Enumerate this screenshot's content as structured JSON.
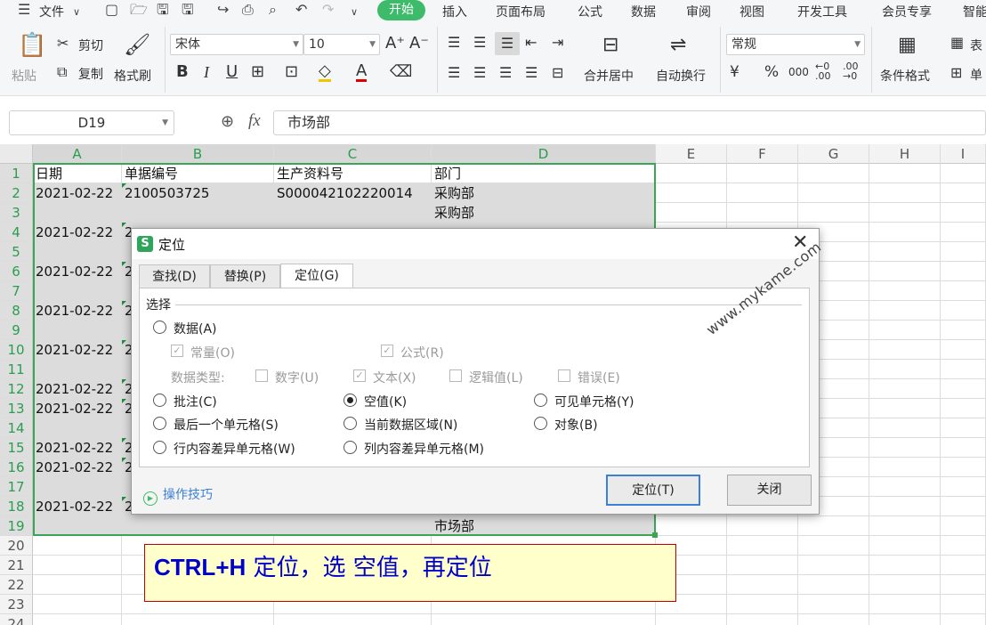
{
  "menubar": {
    "file_label": "文件",
    "tabs": [
      "开始",
      "插入",
      "页面布局",
      "公式",
      "数据",
      "审阅",
      "视图",
      "开发工具",
      "会员专享",
      "智能"
    ]
  },
  "ribbon": {
    "paste": "粘贴",
    "cut": "剪切",
    "copy": "复制",
    "format_painter": "格式刷",
    "font_name": "宋体",
    "font_size": "10",
    "merge_center": "合并居中",
    "wrap_text": "自动换行",
    "number_format": "常规",
    "conditional_format": "条件格式",
    "table_style": "表",
    "cell_more": "单"
  },
  "formula_bar": {
    "name_box": "D19",
    "fx_symbol": "fx",
    "content": "市场部"
  },
  "sheet": {
    "columns": [
      "A",
      "B",
      "C",
      "D",
      "E",
      "F",
      "G",
      "H",
      "I"
    ],
    "rows": [
      {
        "n": "1",
        "a": "日期",
        "b": "单据编号",
        "c": "生产资料号",
        "d": "部门"
      },
      {
        "n": "2",
        "a": "2021-02-22",
        "b": "2100503725",
        "c": "S000042102220014",
        "d": "采购部"
      },
      {
        "n": "3",
        "a": "",
        "b": "",
        "c": "",
        "d": "采购部"
      },
      {
        "n": "4",
        "a": "2021-02-22",
        "b": "2",
        "c": "",
        "d": ""
      },
      {
        "n": "5",
        "a": "",
        "b": "",
        "c": "",
        "d": ""
      },
      {
        "n": "6",
        "a": "2021-02-22",
        "b": "2",
        "c": "",
        "d": ""
      },
      {
        "n": "7",
        "a": "",
        "b": "",
        "c": "",
        "d": ""
      },
      {
        "n": "8",
        "a": "2021-02-22",
        "b": "2",
        "c": "",
        "d": ""
      },
      {
        "n": "9",
        "a": "",
        "b": "",
        "c": "",
        "d": ""
      },
      {
        "n": "10",
        "a": "2021-02-22",
        "b": "2",
        "c": "",
        "d": ""
      },
      {
        "n": "11",
        "a": "",
        "b": "",
        "c": "",
        "d": ""
      },
      {
        "n": "12",
        "a": "2021-02-22",
        "b": "2",
        "c": "",
        "d": ""
      },
      {
        "n": "13",
        "a": "2021-02-22",
        "b": "2",
        "c": "",
        "d": ""
      },
      {
        "n": "14",
        "a": "",
        "b": "",
        "c": "",
        "d": ""
      },
      {
        "n": "15",
        "a": "2021-02-22",
        "b": "2",
        "c": "",
        "d": ""
      },
      {
        "n": "16",
        "a": "2021-02-22",
        "b": "2",
        "c": "",
        "d": ""
      },
      {
        "n": "17",
        "a": "",
        "b": "",
        "c": "",
        "d": ""
      },
      {
        "n": "18",
        "a": "2021-02-22",
        "b": "2",
        "c": "",
        "d": ""
      },
      {
        "n": "19",
        "a": "",
        "b": "",
        "c": "",
        "d": "市场部"
      },
      {
        "n": "20",
        "a": "",
        "b": "",
        "c": "",
        "d": ""
      },
      {
        "n": "21",
        "a": "",
        "b": "",
        "c": "",
        "d": ""
      },
      {
        "n": "22",
        "a": "",
        "b": "",
        "c": "",
        "d": ""
      },
      {
        "n": "23",
        "a": "",
        "b": "",
        "c": "",
        "d": ""
      },
      {
        "n": "24",
        "a": "",
        "b": "",
        "c": "",
        "d": ""
      }
    ]
  },
  "dialog": {
    "title": "定位",
    "tabs": [
      "查找(D)",
      "替换(P)",
      "定位(G)"
    ],
    "group_label": "选择",
    "data_radio": "数据(A)",
    "constant": "常量(O)",
    "formula": "公式(R)",
    "data_type_label": "数据类型:",
    "number": "数字(U)",
    "text": "文本(X)",
    "logical": "逻辑值(L)",
    "error": "错误(E)",
    "comment": "批注(C)",
    "blank": "空值(K)",
    "visible_cells": "可见单元格(Y)",
    "last_cell": "最后一个单元格(S)",
    "current_region": "当前数据区域(N)",
    "objects": "对象(B)",
    "row_diff": "行内容差异单元格(W)",
    "col_diff": "列内容差异单元格(M)",
    "tips": "操作技巧",
    "ok": "定位(T)",
    "close": "关闭"
  },
  "annotation": {
    "keys": "CTRL+H",
    "text": " 定位，选 空值，再定位"
  },
  "watermark": "www.mykame.com"
}
